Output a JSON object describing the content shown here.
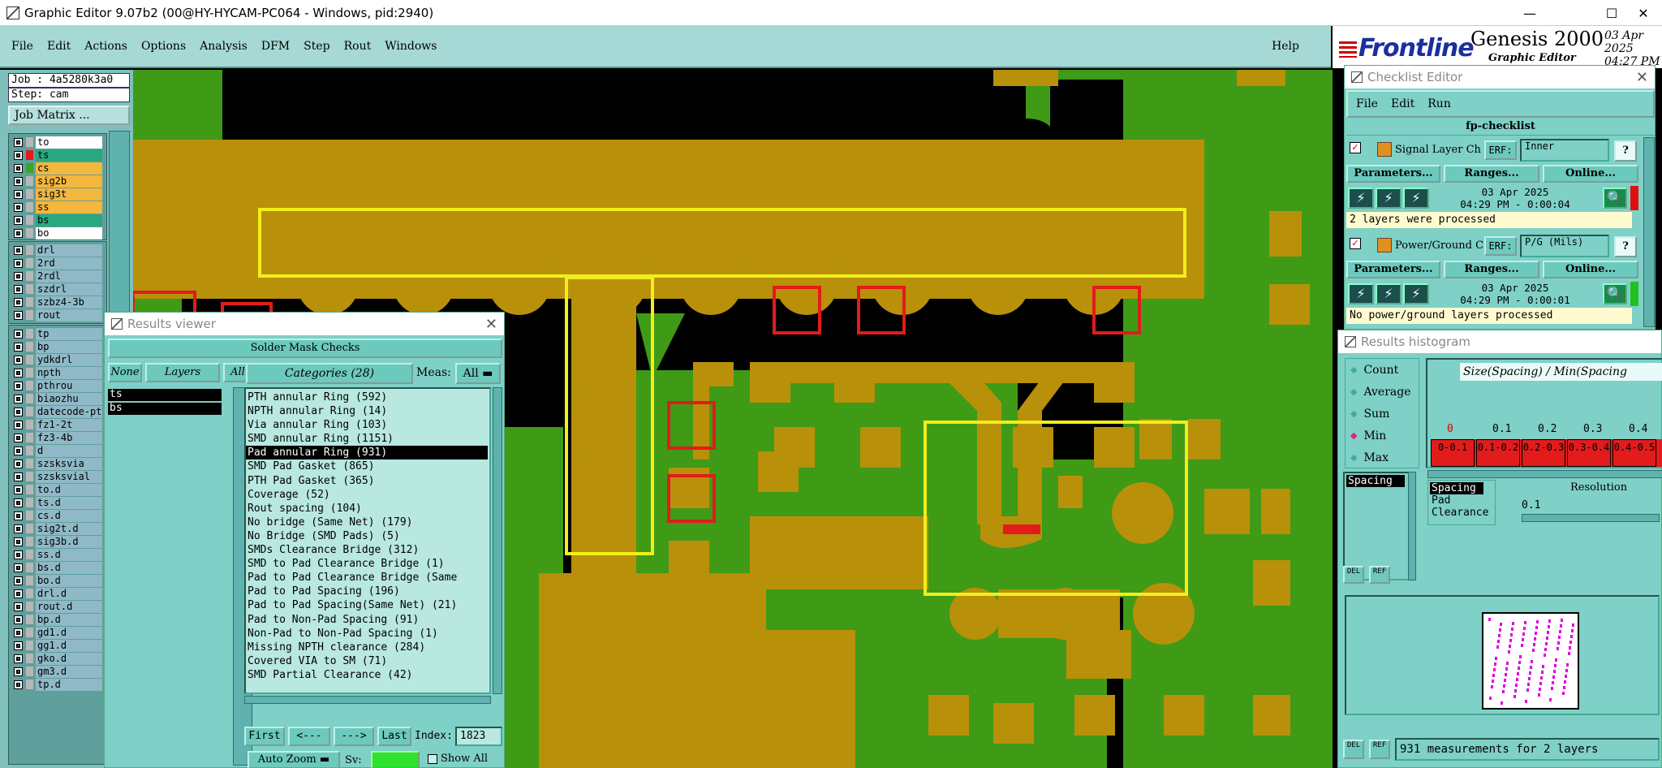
{
  "window": {
    "title": "Graphic Editor 9.07b2 (00@HY-HYCAM-PC064 - Windows, pid:2940)",
    "min": "—",
    "max": "☐",
    "close": "✕"
  },
  "menu": {
    "items": [
      "File",
      "Edit",
      "Actions",
      "Options",
      "Analysis",
      "DFM",
      "Step",
      "Rout",
      "Windows"
    ],
    "help": "Help"
  },
  "brand": {
    "logo": "Frontline",
    "product": "Genesis 2000",
    "subtitle": "Graphic Editor",
    "date": "03 Apr 2025",
    "time": "04:27 PM"
  },
  "left": {
    "job": "Job : 4a5280k3a0",
    "step": "Step: cam",
    "job_matrix": "Job Matrix ...",
    "layers_a": [
      {
        "name": "to",
        "color": "#ffffff",
        "swatch": "#b7b7b7"
      },
      {
        "name": "ts",
        "color": "#2aa87f",
        "swatch": "#e21b1b"
      },
      {
        "name": "cs",
        "color": "#f3b73e",
        "swatch": "#3aa32a"
      },
      {
        "name": "sig2b",
        "color": "#f3b73e",
        "swatch": "#b7b7b7"
      },
      {
        "name": "sig3t",
        "color": "#f3b73e",
        "swatch": "#b7b7b7"
      },
      {
        "name": "ss",
        "color": "#f3b73e",
        "swatch": "#b7b7b7"
      },
      {
        "name": "bs",
        "color": "#2aa87f",
        "swatch": "#b7b7b7"
      },
      {
        "name": "bo",
        "color": "#ffffff",
        "swatch": "#b7b7b7"
      }
    ],
    "layers_b": [
      "drl",
      "2rd",
      "2rdl",
      "szdrl",
      "szbz4-3b",
      "rout"
    ],
    "layers_c": [
      "tp",
      "bp",
      "ydkdrl",
      "npth",
      "pthrou",
      "biaozhu",
      "datecode-pt",
      "fz1-2t",
      "fz3-4b",
      "d",
      "szsksvia",
      "szsksvial",
      "to.d",
      "ts.d",
      "cs.d",
      "sig2t.d",
      "sig3b.d",
      "ss.d",
      "bs.d",
      "bo.d",
      "drl.d",
      "rout.d",
      "bp.d",
      "gd1.d",
      "gg1.d",
      "gko.d",
      "gm3.d",
      "tp.d"
    ]
  },
  "results": {
    "title": "Results viewer",
    "header": "Solder Mask Checks",
    "none": "None",
    "layers": "Layers",
    "all": "All",
    "layer_items": [
      "ts",
      "bs"
    ],
    "categories": "Categories (28)",
    "meas_label": "Meas:",
    "meas_value": "All",
    "items": [
      "PTH annular Ring (592)",
      "NPTH annular Ring (14)",
      "Via annular Ring (103)",
      "SMD annular Ring (1151)",
      "Pad annular Ring (931)",
      "SMD Pad Gasket (865)",
      "PTH Pad Gasket (365)",
      "Coverage (52)",
      "Rout spacing (104)",
      "No bridge (Same Net) (179)",
      "No Bridge (SMD Pads) (5)",
      "SMDs Clearance Bridge (312)",
      "SMD to Pad Clearance Bridge (1)",
      "Pad to Pad Clearance Bridge (Same",
      "Pad to Pad Spacing (196)",
      "Pad to Pad Spacing(Same Net) (21)",
      "Pad to Non-Pad Spacing (91)",
      "Non-Pad to Non-Pad Spacing (1)",
      "Missing NPTH clearance (284)",
      "Covered VIA to SM (71)",
      "SMD Partial Clearance (42)"
    ],
    "selected_index": 4,
    "first": "First",
    "prev": "<---",
    "next": "--->",
    "last": "Last",
    "index_label": "Index:",
    "index_value": "1823",
    "auto_zoom": "Auto Zoom",
    "sv": "Sv:",
    "show_all": "Show All"
  },
  "checklist": {
    "title": "Checklist Editor",
    "menu": [
      "File",
      "Edit",
      "Run"
    ],
    "name": "fp-checklist",
    "actions": [
      {
        "label": "Signal Layer Ch",
        "erf": "ERF:",
        "erf_value": "Inner",
        "params": "Parameters...",
        "ranges": "Ranges...",
        "online": "Online...",
        "date": "03 Apr 2025",
        "time": "04:29 PM - 0:00:04",
        "status": "2 layers were processed",
        "state": "#e01010"
      },
      {
        "label": "Power/Ground C",
        "erf": "ERF:",
        "erf_value": "P/G (Mils)",
        "params": "Parameters...",
        "ranges": "Ranges...",
        "online": "Online...",
        "date": "03 Apr 2025",
        "time": "04:29 PM - 0:00:01",
        "status": "No power/ground layers processed",
        "state": "#20c020"
      }
    ],
    "help": "?"
  },
  "histogram": {
    "title": "Results histogram",
    "options": [
      "Count",
      "Average",
      "Sum",
      "Min",
      "Max"
    ],
    "selected_option": "Min",
    "heading": "Size(Spacing) / Min(Spacing",
    "values": [
      "0",
      "0.1",
      "0.2",
      "0.3",
      "0.4"
    ],
    "ranges": [
      "0-0.1",
      "0.1-0.2",
      "0.2-0.3",
      "0.3-0.4",
      "0.4-0.5"
    ],
    "list_left": [
      "Spacing"
    ],
    "list_right": [
      "Spacing",
      "Pad",
      "Clearance"
    ],
    "resolution_label": "Resolution",
    "resolution_value": "0.1",
    "del": "DEL",
    "ref": "REF",
    "status": "931 measurements for 2 layers"
  }
}
